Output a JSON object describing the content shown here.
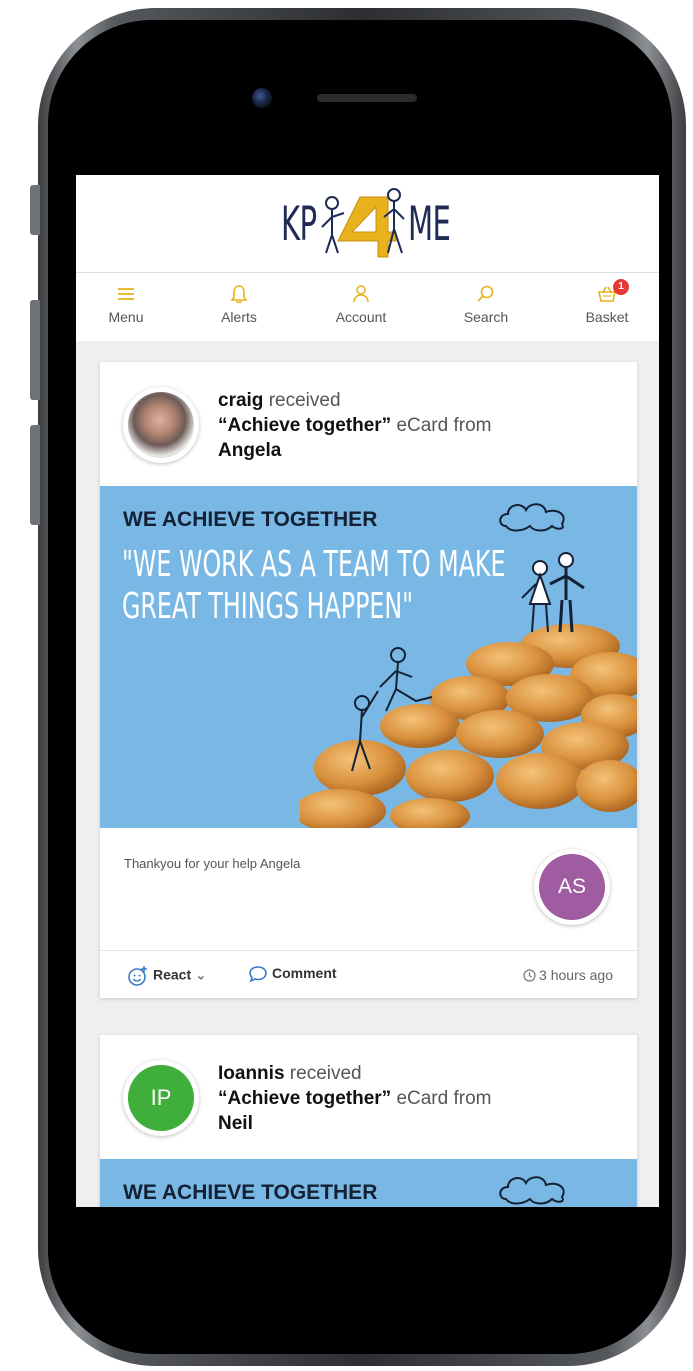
{
  "header": {
    "logo_left": "KP",
    "logo_right": "ME"
  },
  "nav": [
    {
      "label": "Menu",
      "icon": "hamburger-icon"
    },
    {
      "label": "Alerts",
      "icon": "bell-icon"
    },
    {
      "label": "Account",
      "icon": "user-icon"
    },
    {
      "label": "Search",
      "icon": "search-icon"
    },
    {
      "label": "Basket",
      "icon": "basket-icon",
      "badge": "1"
    }
  ],
  "colors": {
    "accent": "#e8b21c",
    "brand_navy": "#1f2a55",
    "banner_blue": "#79b8e4",
    "as_avatar": "#a05ca0",
    "ip_avatar": "#3fae3a"
  },
  "posts": [
    {
      "recipient": "craig",
      "received_word": "received",
      "card_name": "“Achieve together”",
      "ecard_from": "eCard from",
      "sender": "Angela",
      "banner_title": "WE ACHIEVE TOGETHER",
      "banner_quote_line1": "\"WE WORK AS A TEAM TO MAKE",
      "banner_quote_line2": "GREAT THINGS HAPPEN\"",
      "message": "Thankyou for your help Angela",
      "sender_initials": "AS",
      "react_label": "React",
      "comment_label": "Comment",
      "timestamp": "3 hours ago"
    },
    {
      "recipient": "Ioannis",
      "received_word": "received",
      "card_name": "“Achieve together”",
      "ecard_from": "eCard from",
      "sender": "Neil",
      "recipient_initials": "IP",
      "banner_title": "WE ACHIEVE TOGETHER"
    }
  ]
}
